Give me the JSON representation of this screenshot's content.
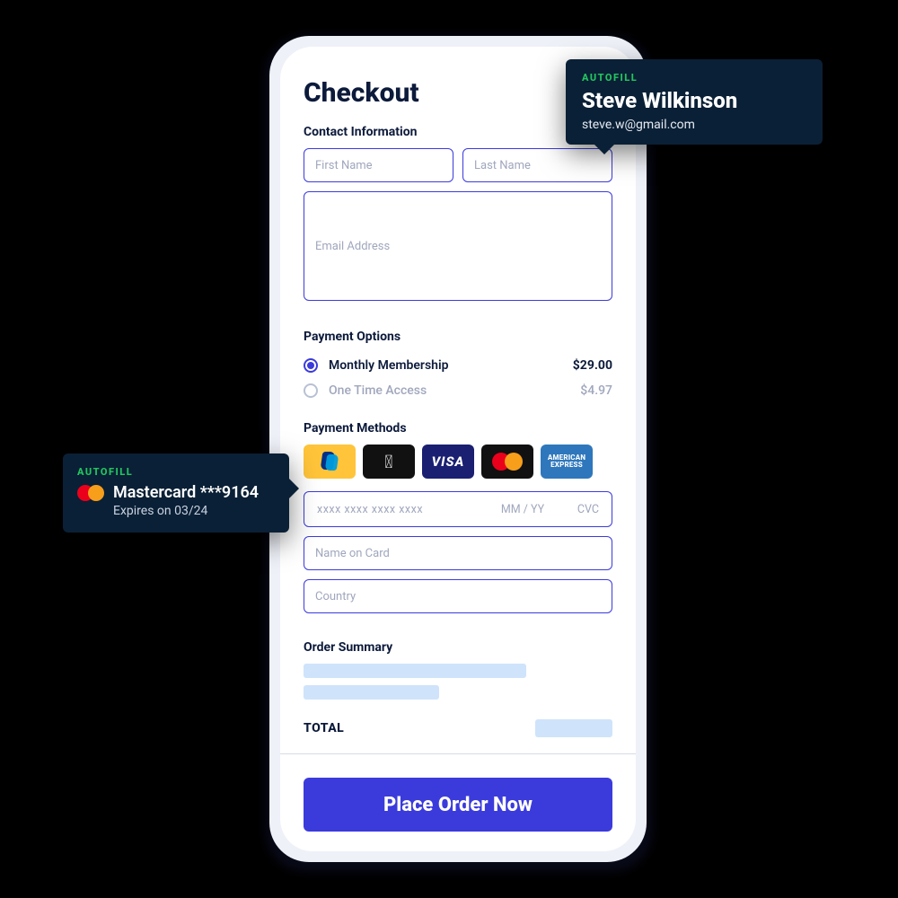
{
  "title": "Checkout",
  "contact": {
    "section_label": "Contact Information",
    "first_name_placeholder": "First Name",
    "last_name_placeholder": "Last Name",
    "email_placeholder": "Email Address"
  },
  "payment_options": {
    "section_label": "Payment Options",
    "options": [
      {
        "label": "Monthly Membership",
        "price": "$29.00",
        "selected": true
      },
      {
        "label": "One Time Access",
        "price": "$4.97",
        "selected": false
      }
    ]
  },
  "payment_methods": {
    "section_label": "Payment Methods",
    "methods": [
      "paypal",
      "apple-pay",
      "visa",
      "mastercard",
      "amex"
    ],
    "visa_text": "VISA",
    "amex_line1": "AMERICAN",
    "amex_line2": "EXPRESS"
  },
  "card_form": {
    "number_placeholder": "xxxx xxxx xxxx xxxx",
    "expiry_placeholder": "MM / YY",
    "cvc_placeholder": "CVC",
    "name_placeholder": "Name on Card",
    "country_placeholder": "Country"
  },
  "summary": {
    "section_label": "Order Summary",
    "total_label": "TOTAL"
  },
  "cta_label": "Place Order Now",
  "autofill_contact": {
    "tag": "AUTOFILL",
    "name": "Steve Wilkinson",
    "email": "steve.w@gmail.com"
  },
  "autofill_card": {
    "tag": "AUTOFILL",
    "title": "Mastercard ***9164",
    "subtitle": "Expires on 03/24"
  }
}
